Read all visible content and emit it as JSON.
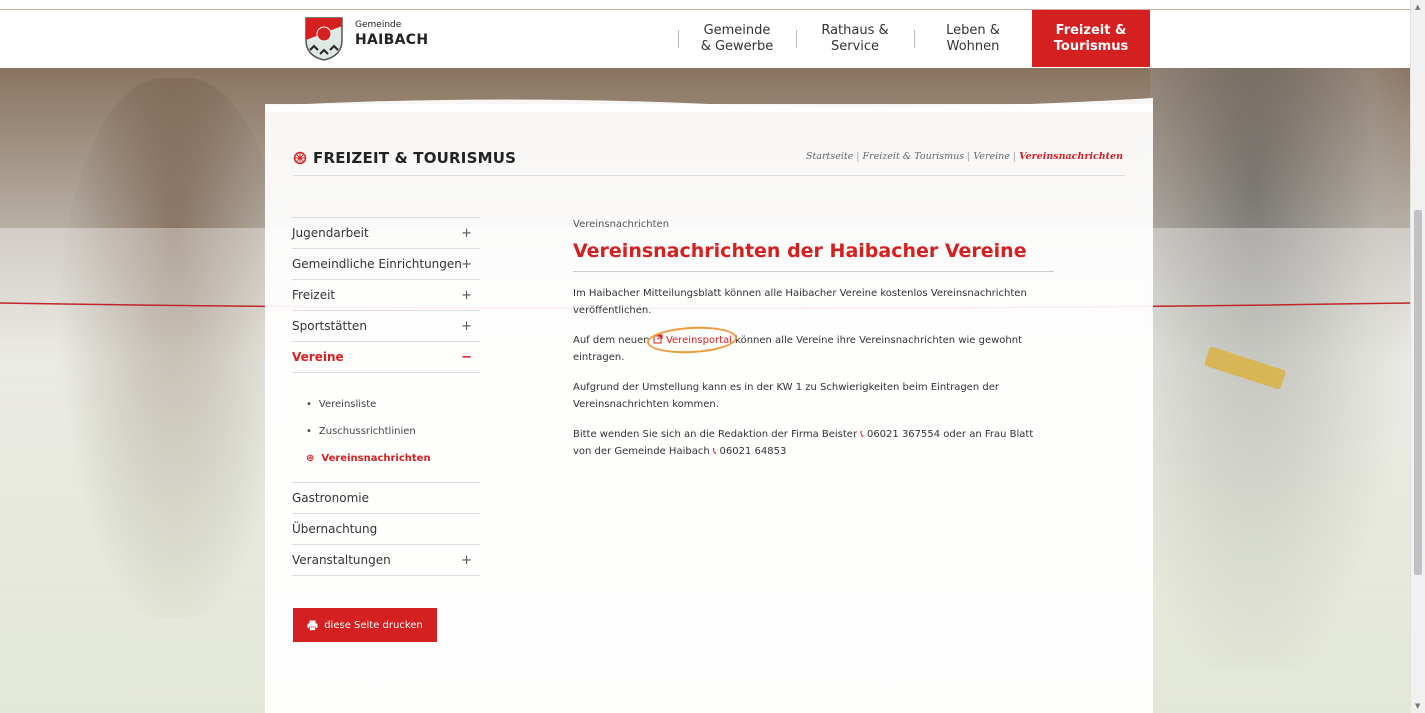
{
  "header": {
    "logo_small": "Gemeinde",
    "logo_big": "HAIBACH",
    "nav": [
      {
        "label": "Gemeinde\n& Gewerbe",
        "active": false
      },
      {
        "label": "Rathaus &\nService",
        "active": false
      },
      {
        "label": "Leben &\nWohnen",
        "active": false
      },
      {
        "label": "Freizeit &\nTourismus",
        "active": true
      }
    ]
  },
  "section": {
    "title": "FREIZEIT & TOURISMUS",
    "breadcrumb": [
      "Startseite",
      "Freizeit & Tourismus",
      "Vereine",
      "Vereinsnachrichten"
    ]
  },
  "sidebar": {
    "items_top": [
      {
        "label": "Jugendarbeit",
        "toggle": "+"
      },
      {
        "label": "Gemeindliche Einrichtungen",
        "toggle": "+"
      },
      {
        "label": "Freizeit",
        "toggle": "+"
      },
      {
        "label": "Sportstätten",
        "toggle": "+"
      },
      {
        "label": "Vereine",
        "toggle": "−"
      }
    ],
    "subitems": [
      {
        "label": "Vereinsliste",
        "bullet": "•"
      },
      {
        "label": "Zuschussrichtlinien",
        "bullet": "•"
      },
      {
        "label": "Vereinsnachrichten",
        "bullet": "⊛"
      }
    ],
    "items_bottom": [
      {
        "label": "Gastronomie",
        "toggle": ""
      },
      {
        "label": "Übernachtung",
        "toggle": ""
      },
      {
        "label": "Veranstaltungen",
        "toggle": "+"
      }
    ],
    "print_label": "diese Seite drucken"
  },
  "main": {
    "eyebrow": "Vereinsnachrichten",
    "title": "Vereinsnachrichten der Haibacher Vereine",
    "p1": "Im Haibacher Mitteilungsblatt können alle Haibacher Vereine kostenlos Vereinsnachrichten veröffentlichen.",
    "p2_before": "Auf dem neuen ",
    "p2_link": "Vereinsportal",
    "p2_after": " können alle Vereine ihre Vereinsnachrichten wie gewohnt eintragen.",
    "p3": "Aufgrund der Umstellung kann es in der KW 1 zu Schwierigkeiten beim Eintragen der Vereinsnachrichten kommen.",
    "p4_before": "Bitte wenden Sie sich an die Redaktion der Firma Beister ",
    "phone1": "06021 367554",
    "p4_middle": " oder an Frau Blatt von der Gemeinde Haibach ",
    "phone2": "06021 64853"
  },
  "colors": {
    "accent": "#d42020",
    "highlight_circle": "#f09a3e"
  }
}
